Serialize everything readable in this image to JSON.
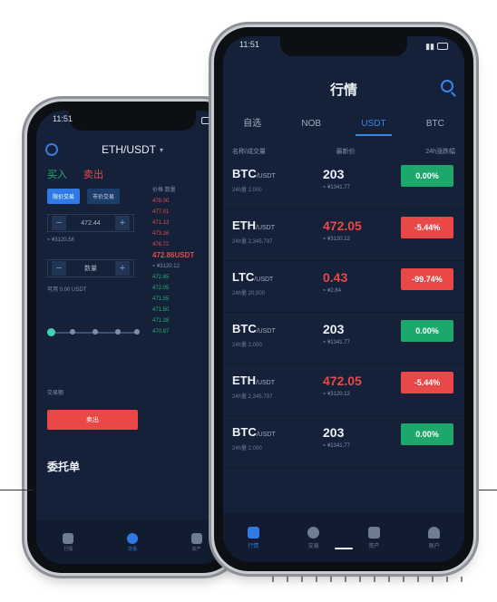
{
  "back": {
    "status_time": "11:51",
    "pair": "ETH/USDT",
    "tab_buy": "买入",
    "tab_sell": "卖出",
    "sub_limit": "限价交易",
    "sub_market": "市价交易",
    "price_value": "472.44",
    "price_cny": "≈ ¥3120.56",
    "amount_placeholder": "数量",
    "available": "可用 0.00 USDT",
    "trade_amount": "交易额",
    "sell_button": "卖出",
    "orders_title": "委托单",
    "book": {
      "header": "价格 数量",
      "asks": [
        "478.00",
        "477.01",
        "471.13",
        "473.16",
        "476.72"
      ],
      "last": "472.86USDT",
      "last_cny": "≈ ¥3120.12",
      "bids": [
        "472.65",
        "472.05",
        "471.55",
        "471.50",
        "471.28",
        "470.87"
      ]
    },
    "nav": [
      "行情",
      "交易",
      "资产"
    ]
  },
  "front": {
    "status_time": "11:51",
    "title": "行情",
    "tabs": [
      "自选",
      "NOB",
      "USDT",
      "BTC"
    ],
    "active_tab": "USDT",
    "columns": [
      "名称/成交量",
      "最新价",
      "24h涨跌幅"
    ],
    "rows": [
      {
        "symbol": "BTC",
        "quote": "/USDT",
        "vol": "24h量 2,000",
        "price": "203",
        "cny": "≈ ¥1341.77",
        "change": "0.00%",
        "dir": "flat"
      },
      {
        "symbol": "ETH",
        "quote": "/USDT",
        "vol": "24h量 2,345.797",
        "price": "472.05",
        "cny": "≈ ¥3120.12",
        "change": "-5.44%",
        "dir": "down"
      },
      {
        "symbol": "LTC",
        "quote": "/USDT",
        "vol": "24h量 20,000",
        "price": "0.43",
        "cny": "≈ ¥2.84",
        "change": "-99.74%",
        "dir": "down"
      },
      {
        "symbol": "BTC",
        "quote": "/USDT",
        "vol": "24h量 2,000",
        "price": "203",
        "cny": "≈ ¥1341.77",
        "change": "0.00%",
        "dir": "flat"
      },
      {
        "symbol": "ETH",
        "quote": "/USDT",
        "vol": "24h量 2,345.797",
        "price": "472.05",
        "cny": "≈ ¥3120.12",
        "change": "-5.44%",
        "dir": "down"
      },
      {
        "symbol": "BTC",
        "quote": "/USDT",
        "vol": "24h量 2,000",
        "price": "203",
        "cny": "≈ ¥1341.77",
        "change": "0.00%",
        "dir": "flat"
      }
    ],
    "nav": [
      "行情",
      "交易",
      "资产",
      "账户"
    ],
    "active_nav": "行情"
  },
  "colors": {
    "bg": "#142139",
    "accent": "#2f7ae5",
    "green": "#1ca86a",
    "red": "#e84848"
  }
}
